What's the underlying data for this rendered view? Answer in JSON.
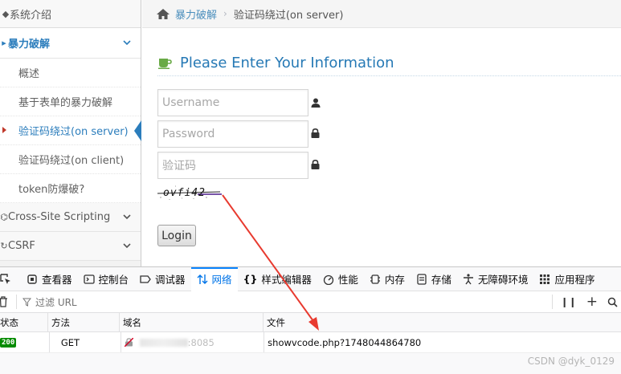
{
  "sidebar": {
    "top_item": "系统介绍",
    "section": {
      "label": "暴力破解",
      "items": [
        {
          "label": "概述"
        },
        {
          "label": "基于表单的暴力破解"
        },
        {
          "label": "验证码绕过(on server)"
        },
        {
          "label": "验证码绕过(on client)"
        },
        {
          "label": "token防爆破?"
        }
      ]
    },
    "other_items": [
      {
        "label": "Cross-Site Scripting"
      },
      {
        "label": "CSRF"
      }
    ]
  },
  "breadcrumb": {
    "parent": "暴力破解",
    "current": "验证码绕过(on server)"
  },
  "form": {
    "title": "Please Enter Your Information",
    "username_placeholder": "Username",
    "password_placeholder": "Password",
    "captcha_placeholder": "验证码",
    "captcha_text": "ovfi42",
    "login_label": "Login"
  },
  "devtools": {
    "tabs": [
      {
        "label": "查看器"
      },
      {
        "label": "控制台"
      },
      {
        "label": "调试器"
      },
      {
        "label": "网络"
      },
      {
        "label": "样式编辑器"
      },
      {
        "label": "性能"
      },
      {
        "label": "内存"
      },
      {
        "label": "存储"
      },
      {
        "label": "无障碍环境"
      },
      {
        "label": "应用程序"
      }
    ],
    "active_tab": "网络",
    "filter_placeholder": "过滤 URL",
    "columns": {
      "status": "状态",
      "method": "方法",
      "domain": "域名",
      "file": "文件"
    },
    "rows": [
      {
        "status": "200",
        "method": "GET",
        "domain": ":8085",
        "file": "showvcode.php?1748044864780"
      }
    ]
  },
  "watermark": "CSDN @dyk_0129",
  "colors": {
    "accent": "#2679b5",
    "status_ok": "#058b00",
    "arrow": "#e83a2f"
  }
}
